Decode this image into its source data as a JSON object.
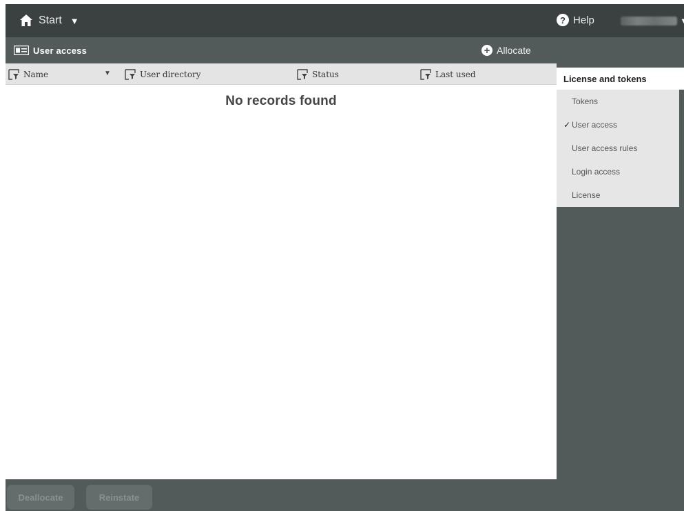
{
  "topbar": {
    "start_label": "Start",
    "help_label": "Help"
  },
  "subbar": {
    "title": "User access",
    "allocate_label": "Allocate"
  },
  "table": {
    "columns": [
      {
        "label": "Name"
      },
      {
        "label": "User directory"
      },
      {
        "label": "Status"
      },
      {
        "label": "Last used"
      }
    ],
    "empty_message": "No records found"
  },
  "footer": {
    "deallocate_label": "Deallocate",
    "reinstate_label": "Reinstate"
  },
  "side_panel": {
    "header": "License and tokens",
    "items": [
      {
        "label": "Tokens",
        "checked": false
      },
      {
        "label": "User access",
        "checked": true,
        "check_mark": "✓"
      },
      {
        "label": "User access rules",
        "checked": false
      },
      {
        "label": "Login access",
        "checked": false
      },
      {
        "label": "License",
        "checked": false
      }
    ]
  },
  "icons": {
    "start": "home-icon",
    "help": "help-circle-icon",
    "user_menu": "chevron-down-icon",
    "subbar": "id-card-icon",
    "allocate": "plus-circle-icon",
    "column_filter": "filter-icon",
    "sort": "sort-down-icon"
  }
}
